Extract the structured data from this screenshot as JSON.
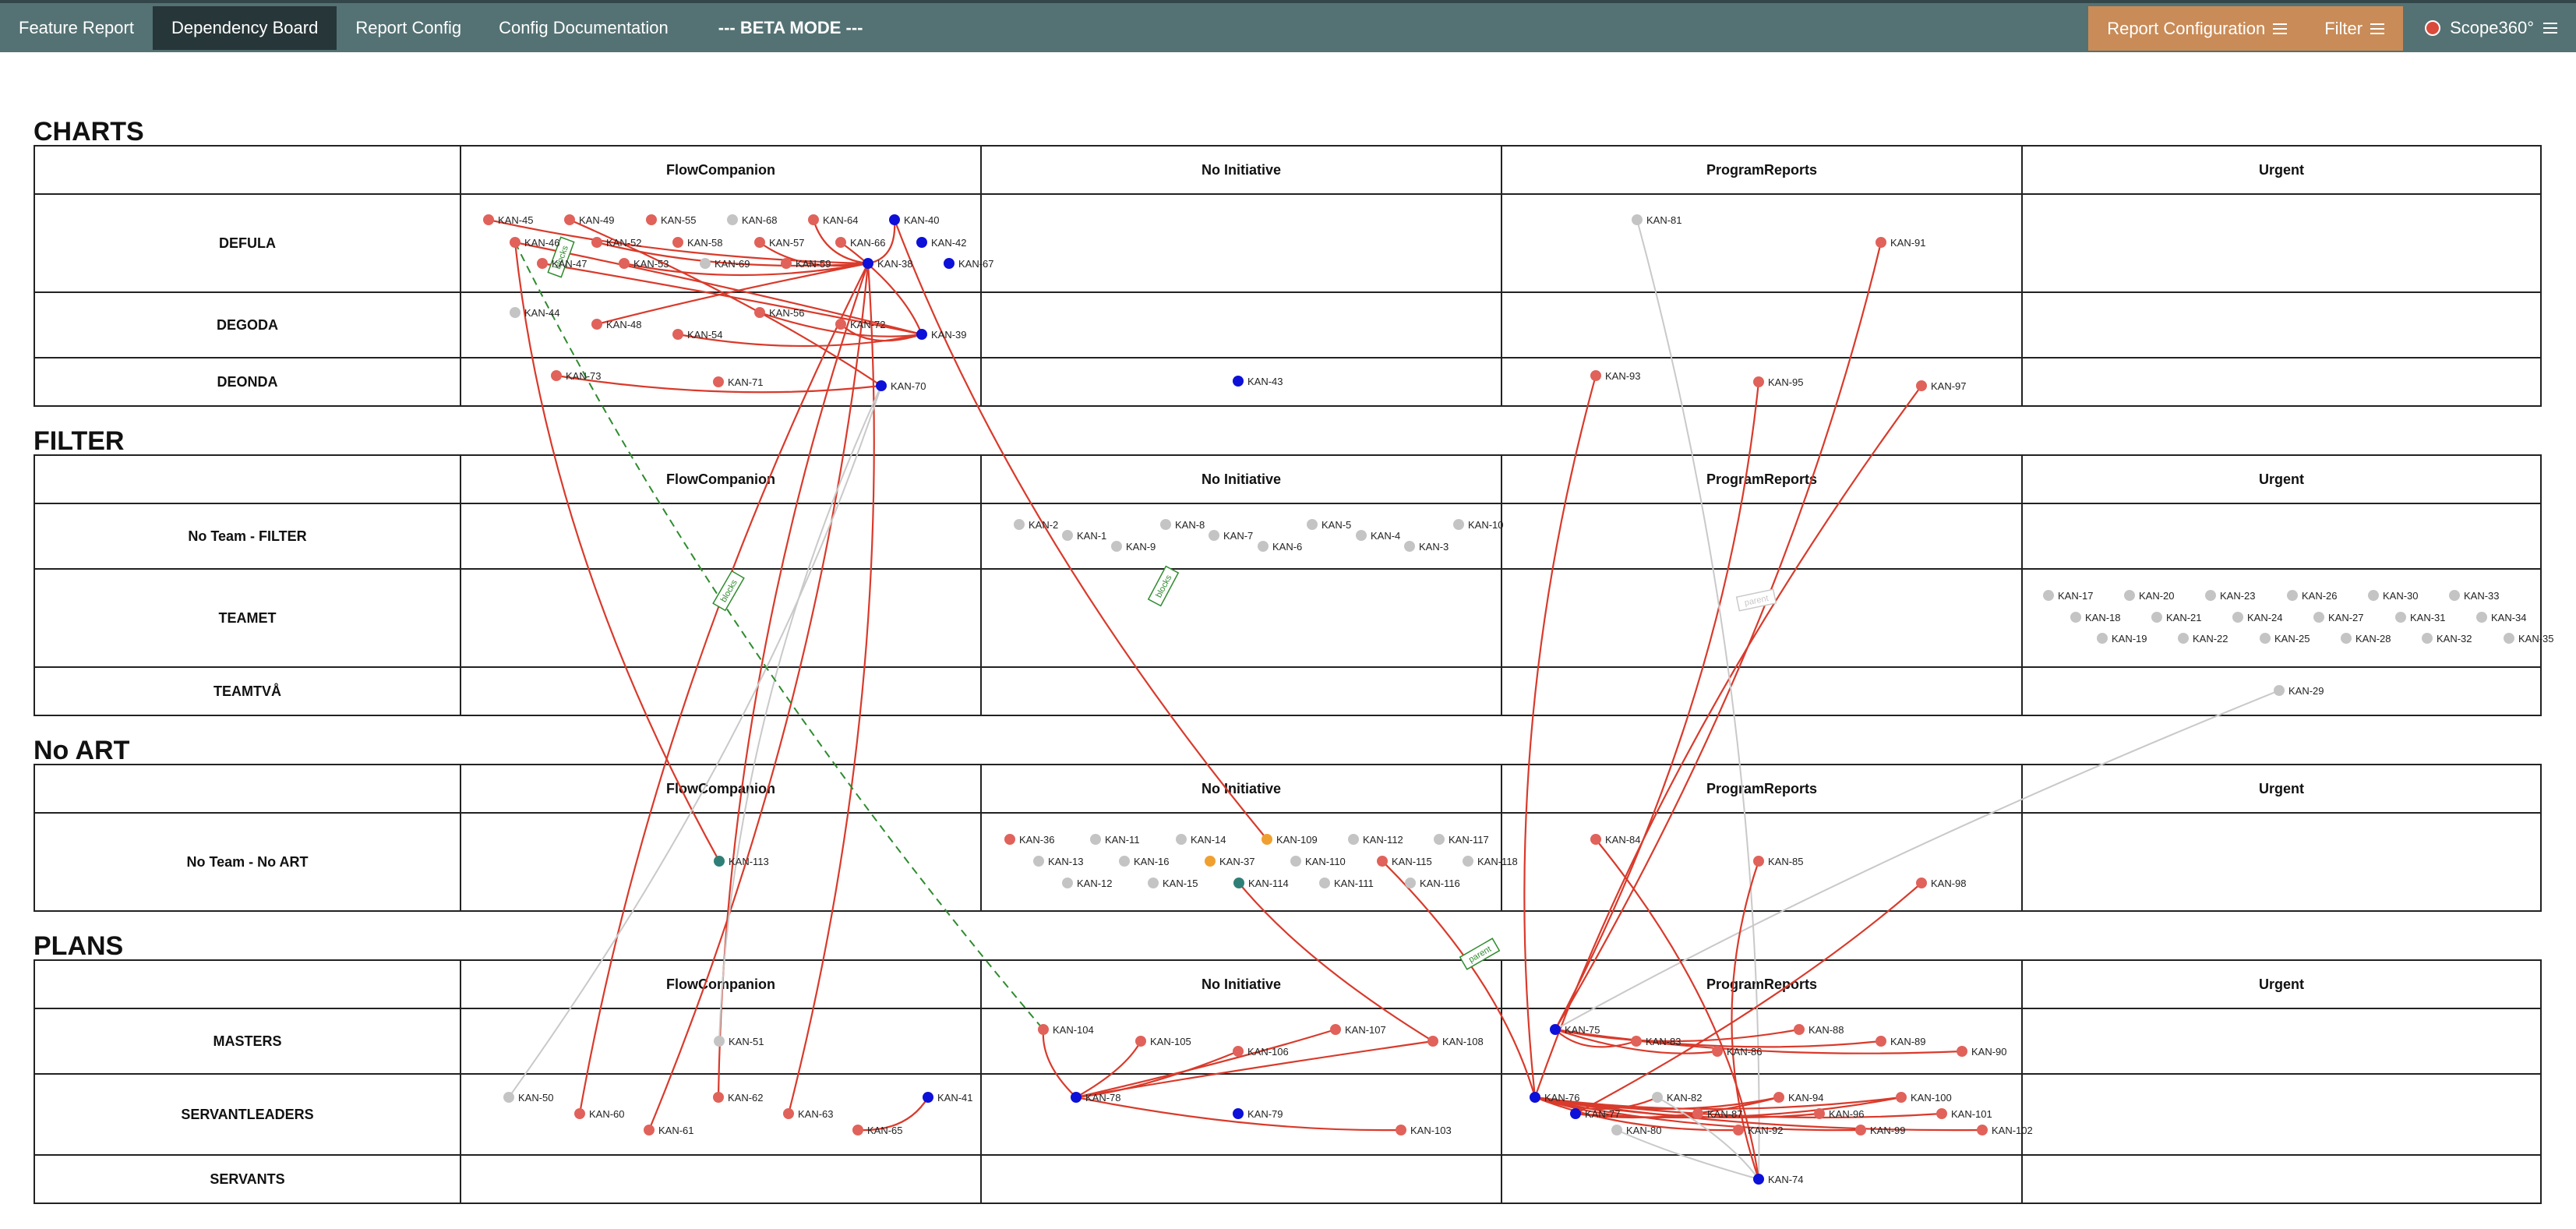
{
  "nav": {
    "tabs": [
      {
        "label": "Feature Report"
      },
      {
        "label": "Dependency Board"
      },
      {
        "label": "Report Config"
      },
      {
        "label": "Config Documentation"
      },
      {
        "label": "--- BETA MODE ---"
      }
    ],
    "report_configuration_label": "Report Configuration",
    "filter_label": "Filter",
    "brand": "Scope360°"
  },
  "board": {
    "columns": [
      "FlowCompanion",
      "No Initiative",
      "ProgramReports",
      "Urgent"
    ],
    "sections": [
      {
        "title": "CHARTS",
        "rows": [
          "DEFULA",
          "DEGODA",
          "DEONDA"
        ]
      },
      {
        "title": "FILTER",
        "rows": [
          "No Team - FILTER",
          "TEAMET",
          "TEAMTVÅ"
        ]
      },
      {
        "title": "No ART",
        "rows": [
          "No Team - No ART"
        ]
      },
      {
        "title": "PLANS",
        "rows": [
          "MASTERS",
          "SERVANTLEADERS",
          "SERVANTS"
        ]
      }
    ]
  },
  "colors": {
    "red": "#e0625a",
    "blue": "#0d10d8",
    "gray": "#c4c4c4",
    "teal": "#2f7f77",
    "orange": "#f0a030",
    "edge_red": "#d93a2b",
    "edge_gray": "#c9c9c9",
    "edge_green": "#2e8b2e"
  },
  "edge_labels": [
    "blocks",
    "parent"
  ],
  "issues": [
    {
      "key": "KAN-45",
      "color": "red"
    },
    {
      "key": "KAN-49",
      "color": "red"
    },
    {
      "key": "KAN-55",
      "color": "red"
    },
    {
      "key": "KAN-68",
      "color": "gray"
    },
    {
      "key": "KAN-64",
      "color": "red"
    },
    {
      "key": "KAN-40",
      "color": "blue"
    },
    {
      "key": "KAN-46",
      "color": "red"
    },
    {
      "key": "KAN-52",
      "color": "red"
    },
    {
      "key": "KAN-58",
      "color": "red"
    },
    {
      "key": "KAN-57",
      "color": "red"
    },
    {
      "key": "KAN-66",
      "color": "red"
    },
    {
      "key": "KAN-42",
      "color": "blue"
    },
    {
      "key": "KAN-47",
      "color": "red"
    },
    {
      "key": "KAN-53",
      "color": "red"
    },
    {
      "key": "KAN-69",
      "color": "gray"
    },
    {
      "key": "KAN-59",
      "color": "red"
    },
    {
      "key": "KAN-38",
      "color": "blue"
    },
    {
      "key": "KAN-67",
      "color": "blue"
    },
    {
      "key": "KAN-44",
      "color": "gray"
    },
    {
      "key": "KAN-56",
      "color": "red"
    },
    {
      "key": "KAN-48",
      "color": "red"
    },
    {
      "key": "KAN-72",
      "color": "red"
    },
    {
      "key": "KAN-54",
      "color": "red"
    },
    {
      "key": "KAN-39",
      "color": "blue"
    },
    {
      "key": "KAN-73",
      "color": "red"
    },
    {
      "key": "KAN-71",
      "color": "red"
    },
    {
      "key": "KAN-70",
      "color": "blue"
    },
    {
      "key": "KAN-43",
      "color": "blue"
    },
    {
      "key": "KAN-81",
      "color": "gray"
    },
    {
      "key": "KAN-91",
      "color": "red"
    },
    {
      "key": "KAN-93",
      "color": "red"
    },
    {
      "key": "KAN-95",
      "color": "red"
    },
    {
      "key": "KAN-97",
      "color": "red"
    },
    {
      "key": "KAN-2",
      "color": "gray"
    },
    {
      "key": "KAN-8",
      "color": "gray"
    },
    {
      "key": "KAN-5",
      "color": "gray"
    },
    {
      "key": "KAN-10",
      "color": "gray"
    },
    {
      "key": "KAN-1",
      "color": "gray"
    },
    {
      "key": "KAN-7",
      "color": "gray"
    },
    {
      "key": "KAN-4",
      "color": "gray"
    },
    {
      "key": "KAN-9",
      "color": "gray"
    },
    {
      "key": "KAN-6",
      "color": "gray"
    },
    {
      "key": "KAN-3",
      "color": "gray"
    },
    {
      "key": "KAN-17",
      "color": "gray"
    },
    {
      "key": "KAN-20",
      "color": "gray"
    },
    {
      "key": "KAN-23",
      "color": "gray"
    },
    {
      "key": "KAN-26",
      "color": "gray"
    },
    {
      "key": "KAN-30",
      "color": "gray"
    },
    {
      "key": "KAN-33",
      "color": "gray"
    },
    {
      "key": "KAN-18",
      "color": "gray"
    },
    {
      "key": "KAN-21",
      "color": "gray"
    },
    {
      "key": "KAN-24",
      "color": "gray"
    },
    {
      "key": "KAN-27",
      "color": "gray"
    },
    {
      "key": "KAN-31",
      "color": "gray"
    },
    {
      "key": "KAN-34",
      "color": "gray"
    },
    {
      "key": "KAN-19",
      "color": "gray"
    },
    {
      "key": "KAN-22",
      "color": "gray"
    },
    {
      "key": "KAN-25",
      "color": "gray"
    },
    {
      "key": "KAN-28",
      "color": "gray"
    },
    {
      "key": "KAN-32",
      "color": "gray"
    },
    {
      "key": "KAN-35",
      "color": "gray"
    },
    {
      "key": "KAN-29",
      "color": "gray"
    },
    {
      "key": "KAN-113",
      "color": "teal"
    },
    {
      "key": "KAN-36",
      "color": "red"
    },
    {
      "key": "KAN-11",
      "color": "gray"
    },
    {
      "key": "KAN-14",
      "color": "gray"
    },
    {
      "key": "KAN-109",
      "color": "orange"
    },
    {
      "key": "KAN-112",
      "color": "gray"
    },
    {
      "key": "KAN-117",
      "color": "gray"
    },
    {
      "key": "KAN-13",
      "color": "gray"
    },
    {
      "key": "KAN-16",
      "color": "gray"
    },
    {
      "key": "KAN-37",
      "color": "orange"
    },
    {
      "key": "KAN-110",
      "color": "gray"
    },
    {
      "key": "KAN-115",
      "color": "red"
    },
    {
      "key": "KAN-118",
      "color": "gray"
    },
    {
      "key": "KAN-12",
      "color": "gray"
    },
    {
      "key": "KAN-15",
      "color": "gray"
    },
    {
      "key": "KAN-114",
      "color": "teal"
    },
    {
      "key": "KAN-111",
      "color": "gray"
    },
    {
      "key": "KAN-116",
      "color": "gray"
    },
    {
      "key": "KAN-84",
      "color": "red"
    },
    {
      "key": "KAN-85",
      "color": "red"
    },
    {
      "key": "KAN-98",
      "color": "red"
    },
    {
      "key": "KAN-51",
      "color": "gray"
    },
    {
      "key": "KAN-50",
      "color": "gray"
    },
    {
      "key": "KAN-60",
      "color": "red"
    },
    {
      "key": "KAN-61",
      "color": "red"
    },
    {
      "key": "KAN-62",
      "color": "red"
    },
    {
      "key": "KAN-63",
      "color": "red"
    },
    {
      "key": "KAN-65",
      "color": "red"
    },
    {
      "key": "KAN-41",
      "color": "blue"
    },
    {
      "key": "KAN-104",
      "color": "red"
    },
    {
      "key": "KAN-105",
      "color": "red"
    },
    {
      "key": "KAN-106",
      "color": "red"
    },
    {
      "key": "KAN-107",
      "color": "red"
    },
    {
      "key": "KAN-108",
      "color": "red"
    },
    {
      "key": "KAN-78",
      "color": "blue"
    },
    {
      "key": "KAN-79",
      "color": "blue"
    },
    {
      "key": "KAN-103",
      "color": "red"
    },
    {
      "key": "KAN-75",
      "color": "blue"
    },
    {
      "key": "KAN-83",
      "color": "red"
    },
    {
      "key": "KAN-86",
      "color": "red"
    },
    {
      "key": "KAN-88",
      "color": "red"
    },
    {
      "key": "KAN-89",
      "color": "red"
    },
    {
      "key": "KAN-90",
      "color": "red"
    },
    {
      "key": "KAN-76",
      "color": "blue"
    },
    {
      "key": "KAN-82",
      "color": "gray"
    },
    {
      "key": "KAN-94",
      "color": "red"
    },
    {
      "key": "KAN-100",
      "color": "red"
    },
    {
      "key": "KAN-77",
      "color": "blue"
    },
    {
      "key": "KAN-87",
      "color": "red"
    },
    {
      "key": "KAN-96",
      "color": "red"
    },
    {
      "key": "KAN-101",
      "color": "red"
    },
    {
      "key": "KAN-80",
      "color": "gray"
    },
    {
      "key": "KAN-92",
      "color": "red"
    },
    {
      "key": "KAN-99",
      "color": "red"
    },
    {
      "key": "KAN-102",
      "color": "red"
    },
    {
      "key": "KAN-74",
      "color": "blue"
    }
  ],
  "links": [
    {
      "from": "KAN-45",
      "to": "KAN-38",
      "kind": "red"
    },
    {
      "from": "KAN-46",
      "to": "KAN-39",
      "kind": "red"
    },
    {
      "from": "KAN-52",
      "to": "KAN-38",
      "kind": "red"
    },
    {
      "from": "KAN-47",
      "to": "KAN-39",
      "kind": "red"
    },
    {
      "from": "KAN-53",
      "to": "KAN-38",
      "kind": "red"
    },
    {
      "from": "KAN-49",
      "to": "KAN-70",
      "kind": "red"
    },
    {
      "from": "KAN-64",
      "to": "KAN-38",
      "kind": "red"
    },
    {
      "from": "KAN-66",
      "to": "KAN-39",
      "kind": "red"
    },
    {
      "from": "KAN-72",
      "to": "KAN-39",
      "kind": "red"
    },
    {
      "from": "KAN-54",
      "to": "KAN-39",
      "kind": "red"
    },
    {
      "from": "KAN-48",
      "to": "KAN-38",
      "kind": "red"
    },
    {
      "from": "KAN-73",
      "to": "KAN-70",
      "kind": "red"
    },
    {
      "from": "KAN-40",
      "to": "KAN-109",
      "kind": "red"
    },
    {
      "from": "KAN-40",
      "to": "KAN-38",
      "kind": "red"
    },
    {
      "from": "KAN-57",
      "to": "KAN-38",
      "kind": "red"
    },
    {
      "from": "KAN-56",
      "to": "KAN-39",
      "kind": "red"
    },
    {
      "from": "KAN-38",
      "to": "KAN-60",
      "kind": "red"
    },
    {
      "from": "KAN-38",
      "to": "KAN-61",
      "kind": "red"
    },
    {
      "from": "KAN-38",
      "to": "KAN-62",
      "kind": "red"
    },
    {
      "from": "KAN-38",
      "to": "KAN-63",
      "kind": "red"
    },
    {
      "from": "KAN-46",
      "to": "KAN-113",
      "kind": "red"
    },
    {
      "from": "KAN-70",
      "to": "KAN-50",
      "kind": "gray"
    },
    {
      "from": "KAN-70",
      "to": "KAN-51",
      "kind": "gray"
    },
    {
      "from": "KAN-65",
      "to": "KAN-41",
      "kind": "red"
    },
    {
      "from": "KAN-46",
      "to": "KAN-104",
      "kind": "green"
    },
    {
      "from": "KAN-91",
      "to": "KAN-75",
      "kind": "red"
    },
    {
      "from": "KAN-93",
      "to": "KAN-76",
      "kind": "red"
    },
    {
      "from": "KAN-95",
      "to": "KAN-75",
      "kind": "red"
    },
    {
      "from": "KAN-97",
      "to": "KAN-76",
      "kind": "red"
    },
    {
      "from": "KAN-81",
      "to": "KAN-74",
      "kind": "gray"
    },
    {
      "from": "KAN-29",
      "to": "KAN-75",
      "kind": "gray"
    },
    {
      "from": "KAN-98",
      "to": "KAN-77",
      "kind": "red"
    },
    {
      "from": "KAN-85",
      "to": "KAN-74",
      "kind": "red"
    },
    {
      "from": "KAN-84",
      "to": "KAN-74",
      "kind": "red"
    },
    {
      "from": "KAN-114",
      "to": "KAN-108",
      "kind": "red"
    },
    {
      "from": "KAN-115",
      "to": "KAN-76",
      "kind": "red"
    },
    {
      "from": "KAN-78",
      "to": "KAN-104",
      "kind": "red"
    },
    {
      "from": "KAN-78",
      "to": "KAN-105",
      "kind": "red"
    },
    {
      "from": "KAN-78",
      "to": "KAN-106",
      "kind": "red"
    },
    {
      "from": "KAN-78",
      "to": "KAN-107",
      "kind": "red"
    },
    {
      "from": "KAN-78",
      "to": "KAN-108",
      "kind": "red"
    },
    {
      "from": "KAN-78",
      "to": "KAN-103",
      "kind": "red"
    },
    {
      "from": "KAN-75",
      "to": "KAN-83",
      "kind": "red"
    },
    {
      "from": "KAN-75",
      "to": "KAN-86",
      "kind": "red"
    },
    {
      "from": "KAN-75",
      "to": "KAN-88",
      "kind": "red"
    },
    {
      "from": "KAN-75",
      "to": "KAN-89",
      "kind": "red"
    },
    {
      "from": "KAN-75",
      "to": "KAN-90",
      "kind": "red"
    },
    {
      "from": "KAN-76",
      "to": "KAN-94",
      "kind": "red"
    },
    {
      "from": "KAN-76",
      "to": "KAN-100",
      "kind": "red"
    },
    {
      "from": "KAN-76",
      "to": "KAN-101",
      "kind": "red"
    },
    {
      "from": "KAN-76",
      "to": "KAN-102",
      "kind": "red"
    },
    {
      "from": "KAN-76",
      "to": "KAN-96",
      "kind": "red"
    },
    {
      "from": "KAN-76",
      "to": "KAN-99",
      "kind": "red"
    },
    {
      "from": "KAN-76",
      "to": "KAN-87",
      "kind": "red"
    },
    {
      "from": "KAN-76",
      "to": "KAN-92",
      "kind": "red"
    },
    {
      "from": "KAN-76",
      "to": "KAN-82",
      "kind": "red"
    },
    {
      "from": "KAN-77",
      "to": "KAN-94",
      "kind": "red"
    },
    {
      "from": "KAN-77",
      "to": "KAN-100",
      "kind": "red"
    },
    {
      "from": "KAN-80",
      "to": "KAN-74",
      "kind": "gray"
    },
    {
      "from": "KAN-82",
      "to": "KAN-74",
      "kind": "gray"
    }
  ]
}
